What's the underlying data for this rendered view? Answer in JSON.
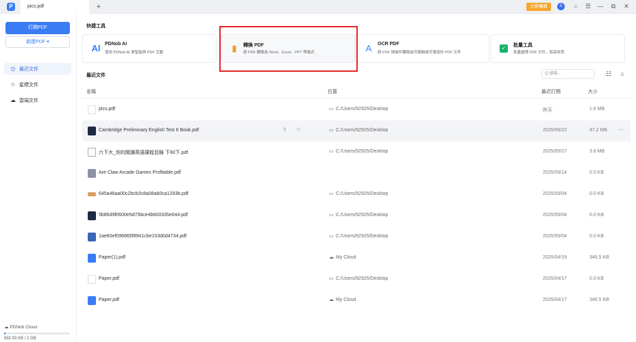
{
  "window": {
    "tab_title": "pics.pdf",
    "new_tab": "+",
    "buy_label": "立即購買",
    "avatar_letter": "S",
    "icons": [
      "bell-icon",
      "menu-icon",
      "minimize-icon",
      "maximize-icon",
      "close-icon"
    ],
    "icon_glyphs": [
      "♤",
      "☰",
      "—",
      "⧉",
      "✕"
    ]
  },
  "sidebar": {
    "open_pdf": "打開PDF",
    "create_pdf": "創建PDF ▾",
    "nav": [
      {
        "label": "最近文件",
        "icon": "◷",
        "active": true
      },
      {
        "label": "星標文件",
        "icon": "☆",
        "active": false
      },
      {
        "label": "雲端文件",
        "icon": "☁",
        "active": false
      }
    ],
    "cloud": {
      "label": "☁ PDNob Cloud",
      "usage": "692.93 KB  /  2 GB",
      "used_fraction": 0.02
    }
  },
  "quick_tools": {
    "title": "快捷工具",
    "items": [
      {
        "title": "PDNob AI",
        "desc": "使用 PDNob AI 更智能與 PDF 互動",
        "icon": "AI",
        "icon_name": "ai-icon",
        "color": "#3a7cf4"
      },
      {
        "title": "轉換 PDF",
        "desc": "將 PDF 轉換為 Word、Excel、PPT 等格式",
        "icon": "▮",
        "icon_name": "convert-icon",
        "color": "#f39a28"
      },
      {
        "title": "OCR PDF",
        "desc": "將 PDF 掃描件轉換為可編輯或可搜尋的 PDF 文件",
        "icon": "A",
        "icon_name": "ocr-icon",
        "color": "#3a7cf4"
      },
      {
        "title": "批量工具",
        "desc": "批量處理 PDF 文件，提高效率",
        "icon": "✓",
        "icon_name": "batch-icon",
        "color": "#1bb06e"
      }
    ]
  },
  "recent": {
    "title": "最近文件",
    "search_placeholder": "Q 搜尋...",
    "columns": {
      "name": "名稱",
      "location": "位置",
      "last_opened": "最近打開",
      "size": "大小"
    },
    "files": [
      {
        "name": "pics.pdf",
        "location": "C:/Users/92925/Desktop",
        "loc_icon": "folder",
        "date": "昨天",
        "size": "1.6 MB",
        "thumb": "blank"
      },
      {
        "name": "Cambridge Preliminary English Test 6 Book.pdf",
        "location": "C:/Users/92925/Desktop",
        "loc_icon": "folder",
        "date": "2025/06/22",
        "size": "47.2 MB",
        "thumb": "dark",
        "selected": true
      },
      {
        "name": "六下大_你的閱讀英語課程目錄 下90下.pdf",
        "location": "C:/Users/92925/Desktop",
        "loc_icon": "folder",
        "date": "2025/05/27",
        "size": "3.8 MB",
        "thumb": "doc"
      },
      {
        "name": "Are Claw Arcade Games Profitable.pdf",
        "location": "",
        "loc_icon": "",
        "date": "2025/05/14",
        "size": "0.0 KB",
        "thumb": "img"
      },
      {
        "name": "645a46aa00c2bcb3c8a08ab0ca1293b.pdf",
        "location": "C:/Users/92925/Desktop",
        "loc_icon": "folder",
        "date": "2025/05/04",
        "size": "0.0 KB",
        "thumb": "strip"
      },
      {
        "name": "5b86d9f0600e5d75bce4b600335e044.pdf",
        "location": "C:/Users/92925/Desktop",
        "loc_icon": "folder",
        "date": "2025/05/04",
        "size": "0.0 KB",
        "thumb": "dark"
      },
      {
        "name": "1ae60ef096865f8941cbe153d0d4734.pdf",
        "location": "C:/Users/92925/Desktop",
        "loc_icon": "folder",
        "date": "2025/05/04",
        "size": "0.0 KB",
        "thumb": "blue"
      },
      {
        "name": "Paper(1).pdf",
        "location": "My Cloud",
        "loc_icon": "cloud",
        "date": "2025/04/19",
        "size": "346.5 KB",
        "thumb": "logo"
      },
      {
        "name": "Paper.pdf",
        "location": "C:/Users/92925/Desktop",
        "loc_icon": "folder",
        "date": "2025/04/17",
        "size": "0.0 KB",
        "thumb": "blank"
      },
      {
        "name": "Paper.pdf",
        "location": "My Cloud",
        "loc_icon": "cloud",
        "date": "2025/04/17",
        "size": "346.5 KB",
        "thumb": "logo"
      }
    ],
    "row_actions": {
      "share": "⇪",
      "star": "☆",
      "more": "⋯"
    }
  }
}
